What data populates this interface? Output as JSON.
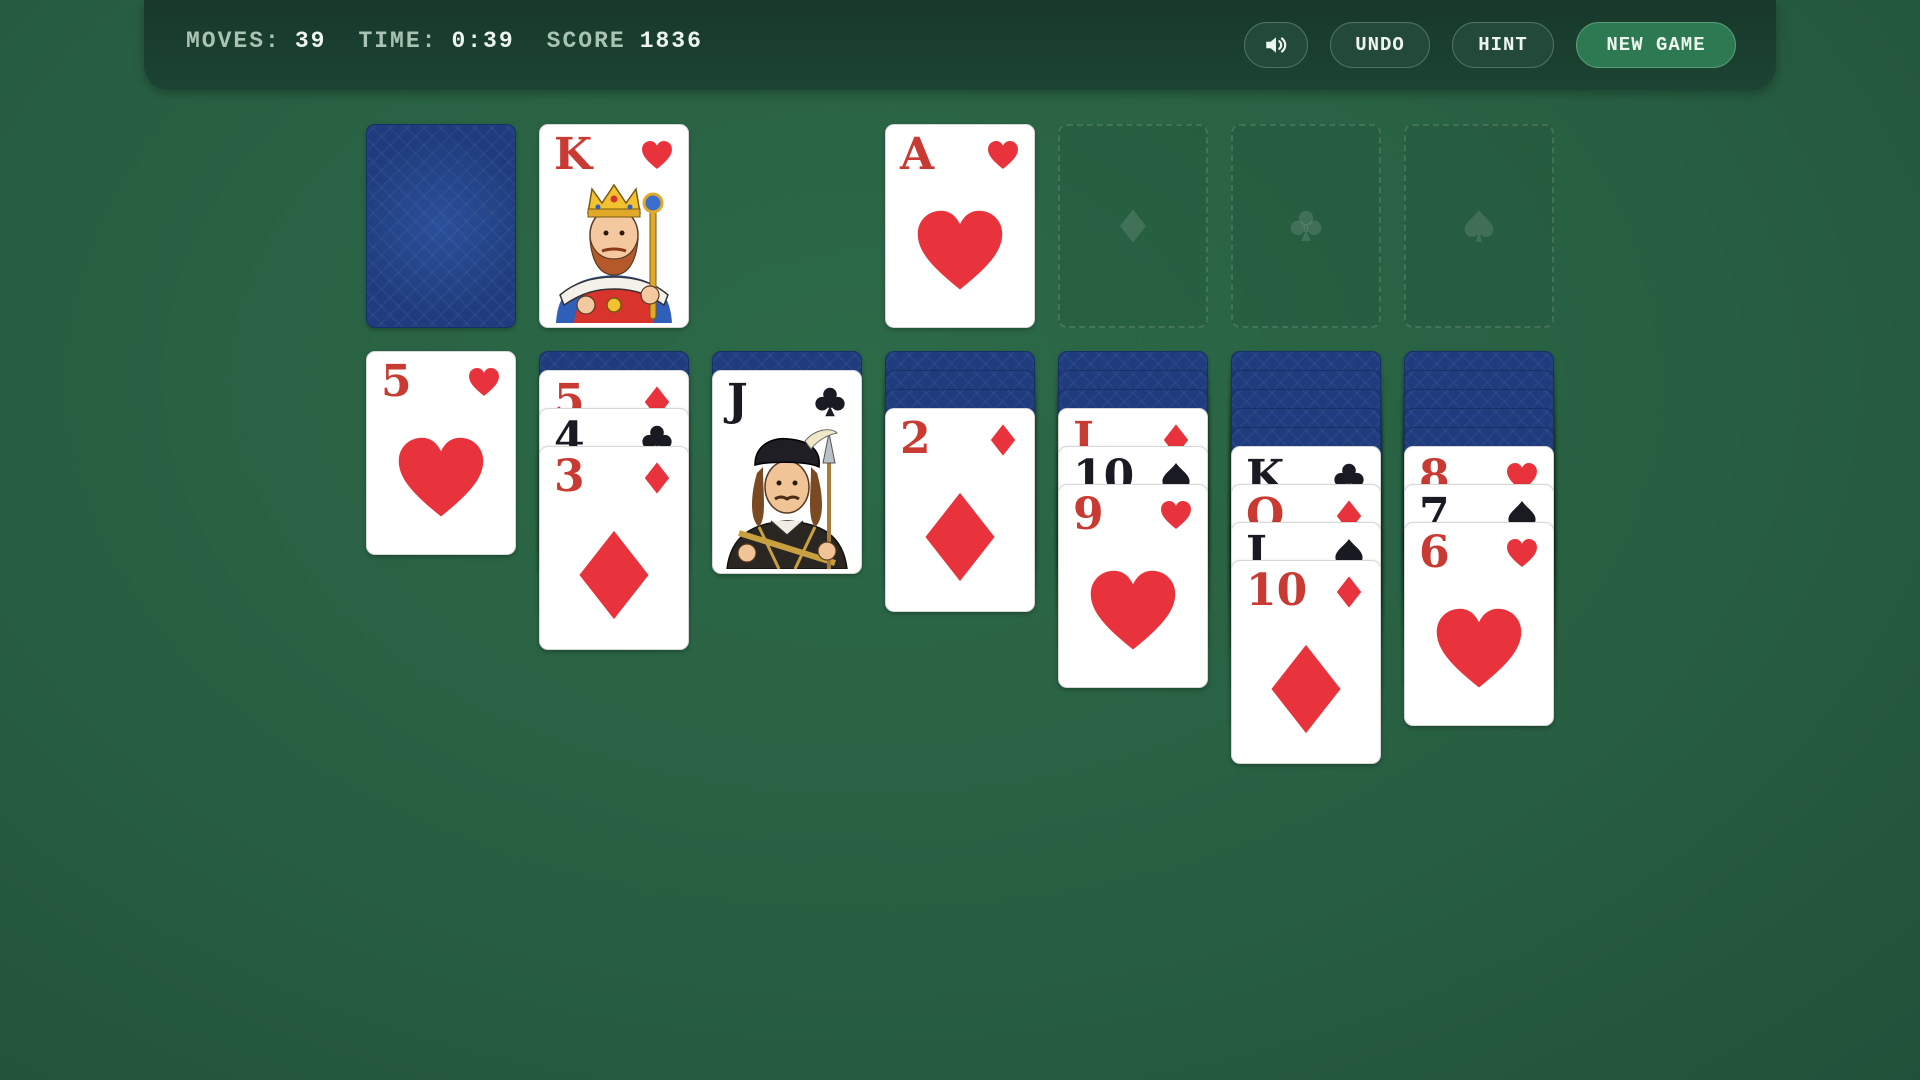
{
  "header": {
    "moves_label": "MOVES:",
    "moves_value": "39",
    "time_label": "TIME:",
    "time_value": "0:39",
    "score_label": "SCORE",
    "score_value": "1836",
    "sound_icon": "speaker-icon",
    "undo_label": "UNDO",
    "hint_label": "HINT",
    "new_game_label": "NEW GAME"
  },
  "colors": {
    "table": "#285f42",
    "card_back": "#1f3d7e",
    "red_suit": "#e8323c",
    "black_suit": "#1a1a22",
    "new_game_button": "#2d7a52"
  },
  "stock": {
    "face_down": true
  },
  "waste": {
    "rank": "K",
    "suit": "hearts",
    "face": "king"
  },
  "foundations": [
    {
      "rank": "A",
      "suit": "hearts"
    },
    {
      "empty": true,
      "suit": "diamonds"
    },
    {
      "empty": true,
      "suit": "clubs"
    },
    {
      "empty": true,
      "suit": "spades"
    }
  ],
  "tableau": [
    {
      "hidden": 0,
      "cards": [
        {
          "rank": "5",
          "suit": "hearts"
        }
      ]
    },
    {
      "hidden": 1,
      "cards": [
        {
          "rank": "5",
          "suit": "diamonds"
        },
        {
          "rank": "4",
          "suit": "clubs"
        },
        {
          "rank": "3",
          "suit": "diamonds"
        }
      ]
    },
    {
      "hidden": 1,
      "cards": [
        {
          "rank": "J",
          "suit": "clubs",
          "face": "jack"
        }
      ]
    },
    {
      "hidden": 3,
      "cards": [
        {
          "rank": "2",
          "suit": "diamonds"
        }
      ]
    },
    {
      "hidden": 3,
      "cards": [
        {
          "rank": "J",
          "suit": "diamonds"
        },
        {
          "rank": "10",
          "suit": "spades"
        },
        {
          "rank": "9",
          "suit": "hearts"
        }
      ]
    },
    {
      "hidden": 5,
      "cards": [
        {
          "rank": "K",
          "suit": "clubs"
        },
        {
          "rank": "Q",
          "suit": "diamonds"
        },
        {
          "rank": "J",
          "suit": "spades"
        },
        {
          "rank": "10",
          "suit": "diamonds"
        }
      ]
    },
    {
      "hidden": 5,
      "cards": [
        {
          "rank": "8",
          "suit": "hearts"
        },
        {
          "rank": "7",
          "suit": "spades"
        },
        {
          "rank": "6",
          "suit": "hearts"
        }
      ]
    }
  ]
}
